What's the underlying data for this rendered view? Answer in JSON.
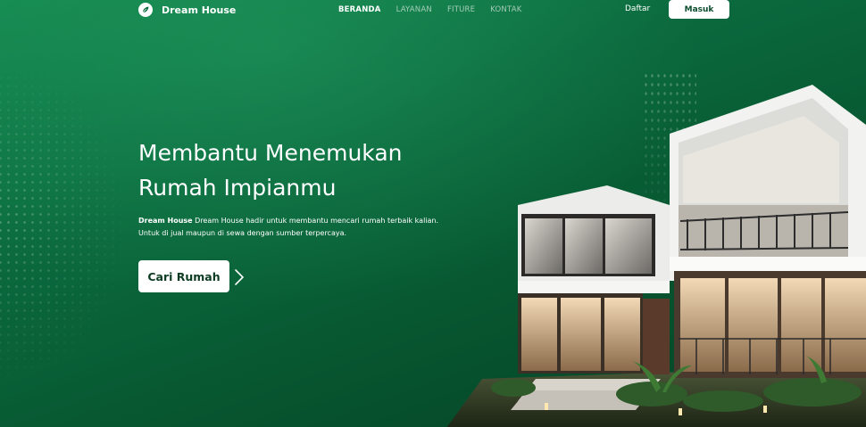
{
  "nav": {
    "brand": "Dream House",
    "menu": [
      "BERANDA",
      "LAYANAN",
      "FITURE",
      "KONTAK"
    ],
    "daftar": "Daftar",
    "masuk": "Masuk"
  },
  "hero": {
    "headline_line1": "Membantu Menemukan",
    "headline_line2": "Rumah Impianmu",
    "desc_brand": "Dream House",
    "desc_line1": "Dream House hadir untuk membantu mencari rumah terbaik kalian.",
    "desc_line2": "Untuk di jual maupun di sewa dengan sumber terpercaya.",
    "cta": "Cari Rumah"
  },
  "icons": {
    "logo": "leaf-logo-icon",
    "cta_arrow": "chevron-right-icon"
  },
  "colors": {
    "bg_top": "#13884f",
    "bg_bottom": "#053f24",
    "button_bg": "#ffffff",
    "button_text": "#0c3b22"
  }
}
